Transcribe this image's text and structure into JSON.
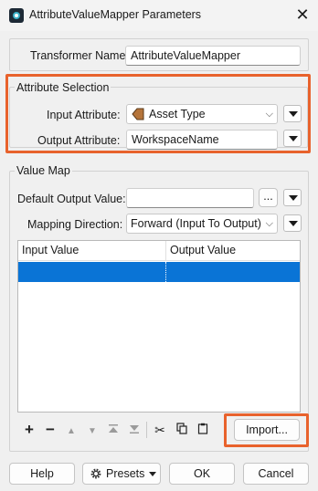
{
  "window": {
    "title": "AttributeValueMapper Parameters",
    "close_glyph": "✕"
  },
  "transformer_name": {
    "label": "Transformer Name:",
    "value": "AttributeValueMapper"
  },
  "attribute_selection": {
    "title": "Attribute Selection",
    "input_label": "Input Attribute:",
    "input_value": "Asset Type",
    "output_label": "Output Attribute:",
    "output_value": "WorkspaceName"
  },
  "value_map": {
    "title": "Value Map",
    "default_output_label": "Default Output Value:",
    "default_output_value": "",
    "ellipsis_label": "...",
    "mapping_direction_label": "Mapping Direction:",
    "mapping_direction_value": "Forward (Input To Output)",
    "columns": [
      "Input Value",
      "Output Value"
    ],
    "rows": [
      {
        "input": "",
        "output": ""
      }
    ]
  },
  "toolbar": {
    "add": "+",
    "remove": "−",
    "import_label": "Import..."
  },
  "footer": {
    "help": "Help",
    "presets": "Presets",
    "ok": "OK",
    "cancel": "Cancel"
  },
  "colors": {
    "highlight": "#e8622c",
    "selection": "#0a74d6"
  }
}
